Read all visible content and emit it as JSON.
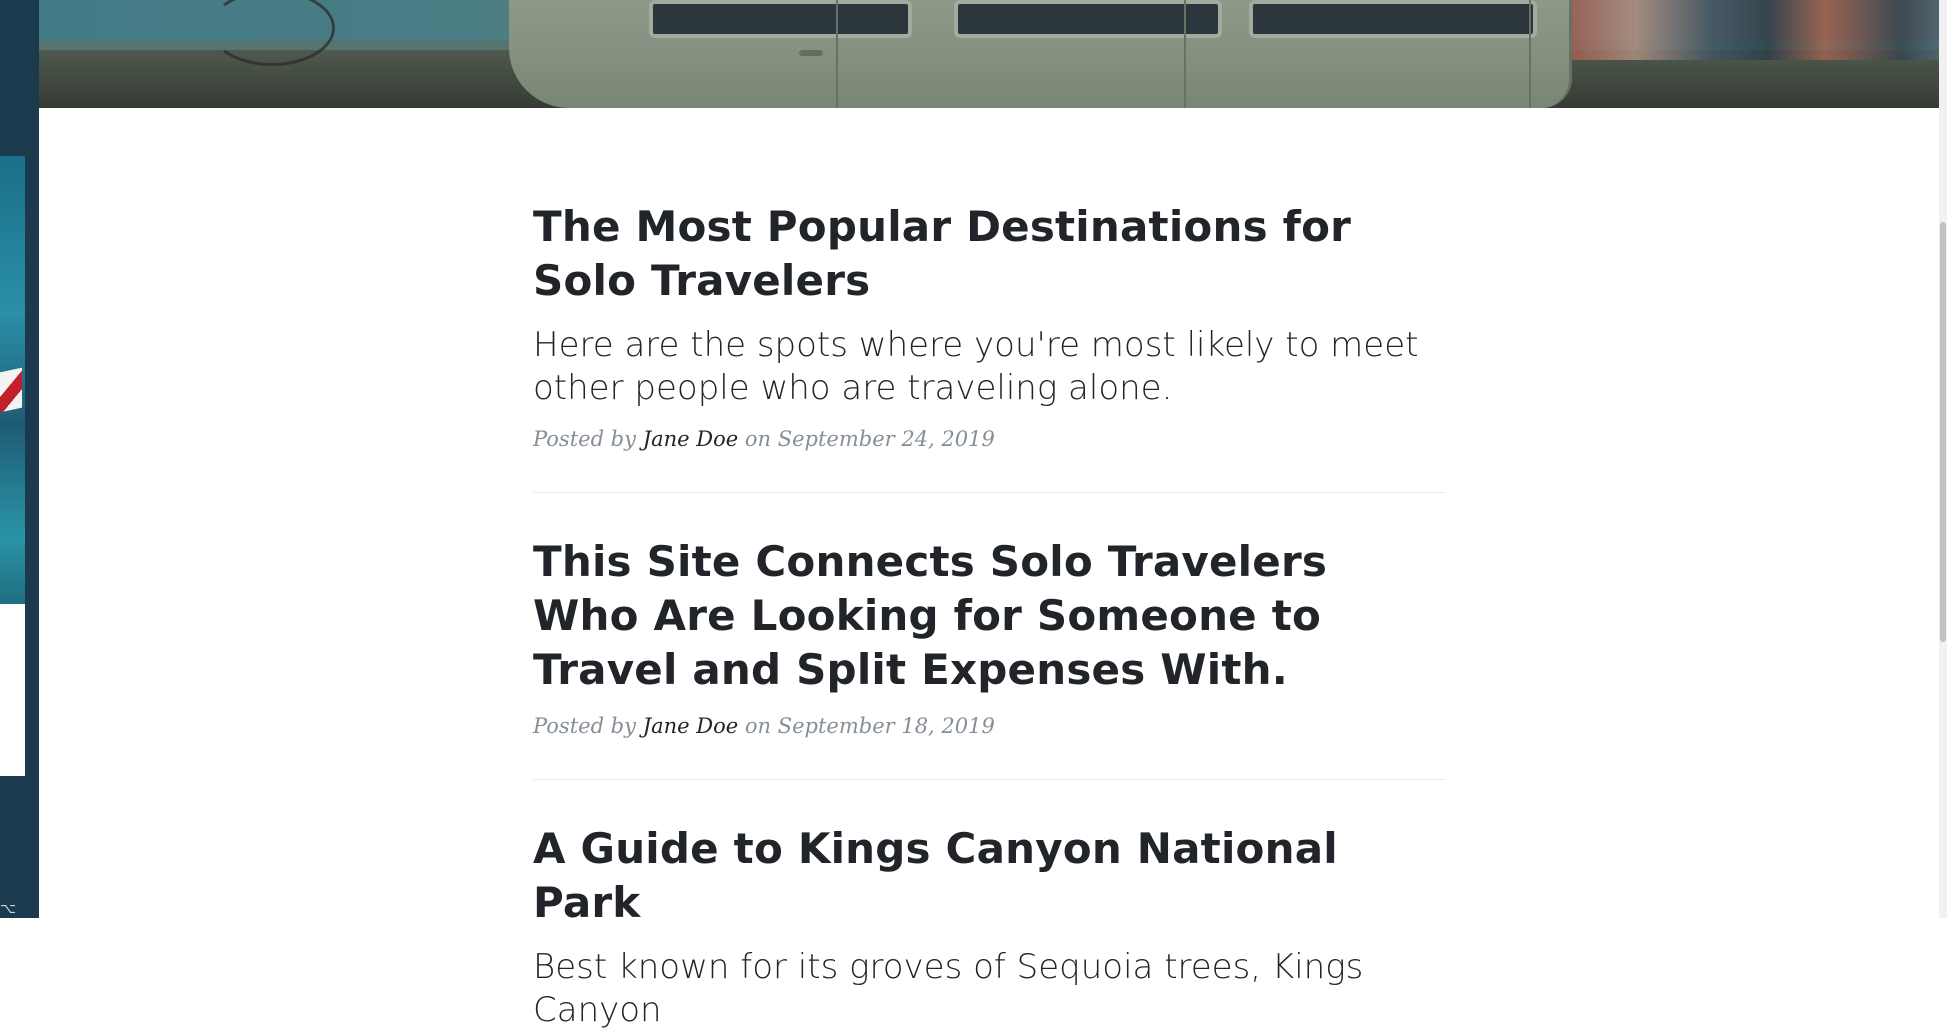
{
  "posts": [
    {
      "title": "The Most Popular Destinations for Solo Travelers",
      "subtitle": "Here are the spots where you're most likely to meet other people who are traveling alone.",
      "meta_prefix": "Posted by",
      "author": "Jane Doe",
      "meta_middle": "on",
      "date": "September 24, 2019"
    },
    {
      "title": "This Site Connects Solo Travelers Who Are Looking for Someone to Travel and Split Expenses With.",
      "subtitle": "",
      "meta_prefix": "Posted by",
      "author": "Jane Doe",
      "meta_middle": "on",
      "date": "September 18, 2019"
    },
    {
      "title": "A Guide to Kings Canyon National Park",
      "subtitle": "Best known for its groves of Sequoia trees, Kings Canyon"
    }
  ],
  "colors": {
    "text": "#212529",
    "meta": "#868e96",
    "divider": "#e9ecef"
  }
}
